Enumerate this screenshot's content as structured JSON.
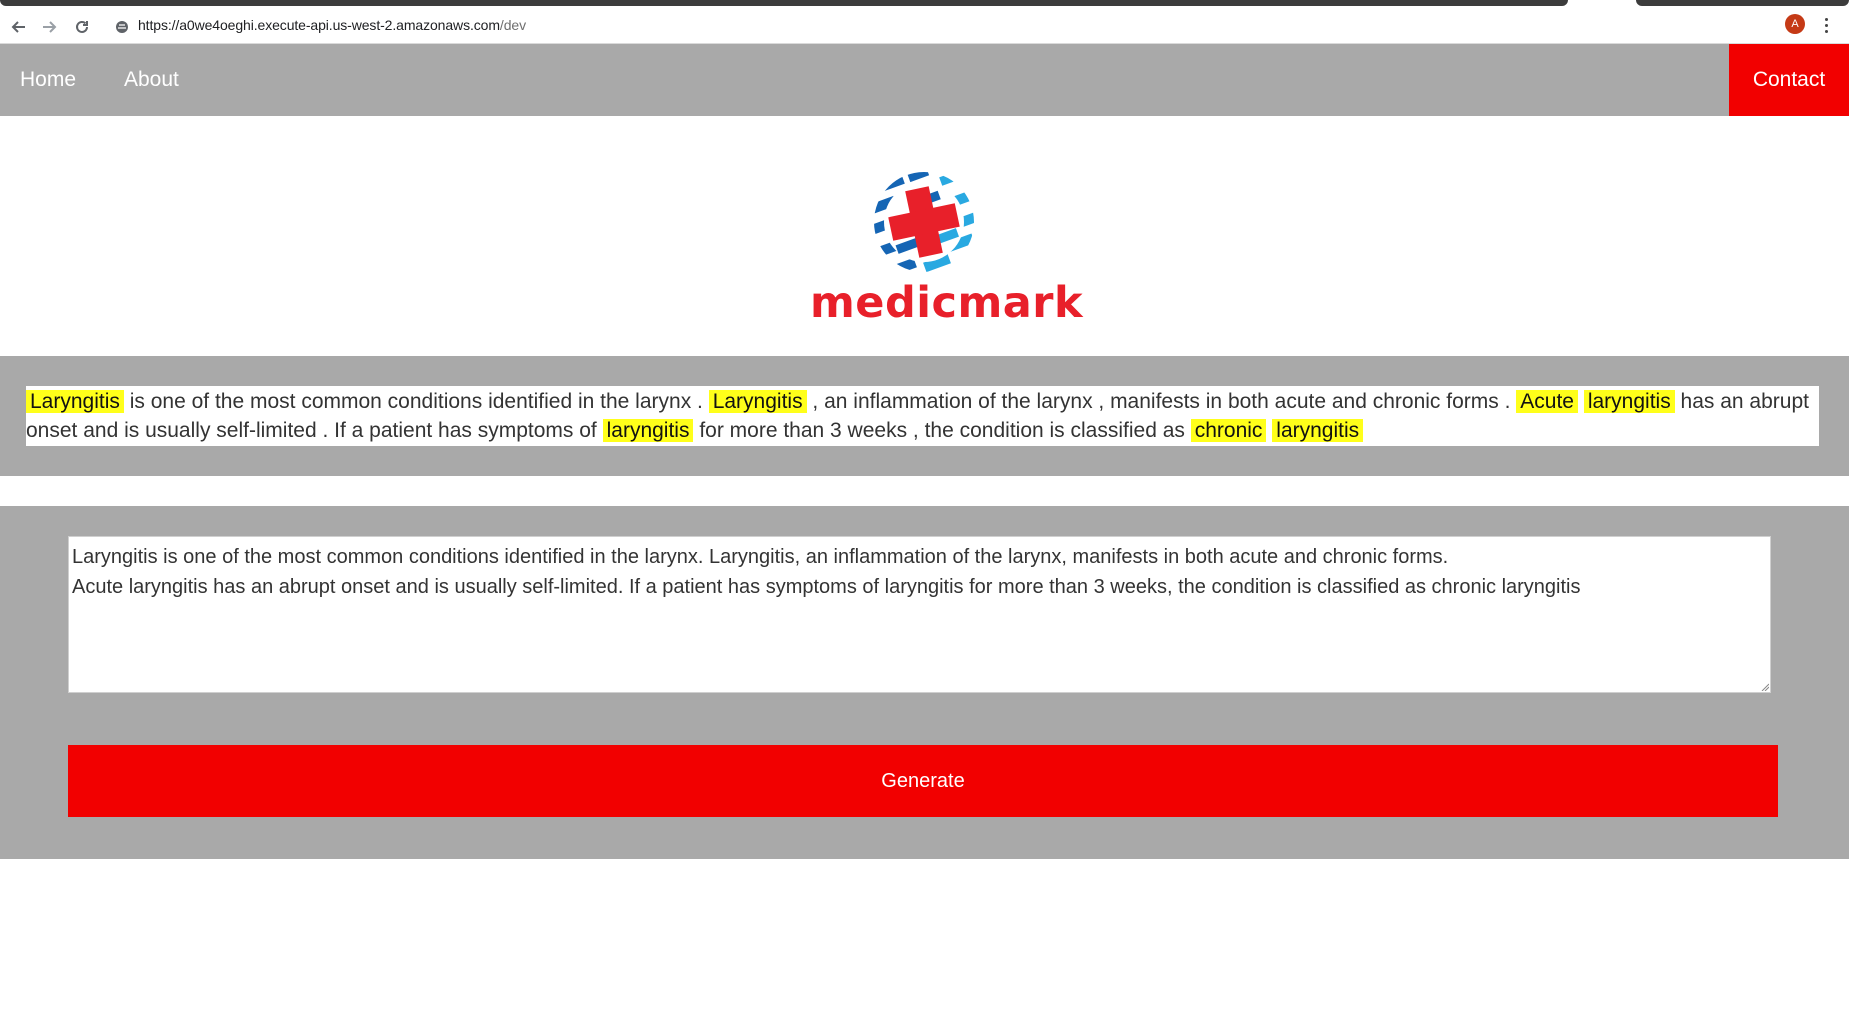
{
  "browser": {
    "url_main": "https://a0we4oeghi.execute-api.us-west-2.amazonaws.com",
    "url_path": "/dev",
    "avatar_initial": "A"
  },
  "nav": {
    "home": "Home",
    "about": "About",
    "contact": "Contact"
  },
  "logo": {
    "text": "medicmark"
  },
  "highlight": {
    "segments": [
      {
        "text": "Laryngitis",
        "hl": true
      },
      {
        "text": " is one of the most common conditions identified in the larynx . ",
        "hl": false
      },
      {
        "text": "Laryngitis",
        "hl": true
      },
      {
        "text": " , an inflammation of the larynx , manifests in both acute and chronic forms . ",
        "hl": false
      },
      {
        "text": "Acute",
        "hl": true
      },
      {
        "text": " ",
        "hl": false
      },
      {
        "text": "laryngitis",
        "hl": true
      },
      {
        "text": " has an abrupt onset and is usually self-limited . If a patient has symptoms of ",
        "hl": false
      },
      {
        "text": "laryngitis",
        "hl": true
      },
      {
        "text": " for more than 3 weeks , the condition is classified as ",
        "hl": false
      },
      {
        "text": "chronic",
        "hl": true
      },
      {
        "text": " ",
        "hl": false
      },
      {
        "text": "laryngitis",
        "hl": true
      }
    ]
  },
  "form": {
    "textarea_value": "Laryngitis is one of the most common conditions identified in the larynx. Laryngitis, an inflammation of the larynx, manifests in both acute and chronic forms.\nAcute laryngitis has an abrupt onset and is usually self-limited. If a patient has symptoms of laryngitis for more than 3 weeks, the condition is classified as chronic laryngitis",
    "generate_label": "Generate"
  },
  "colors": {
    "nav_bg": "#a9a9a9",
    "accent_red": "#f20000",
    "highlight": "#ffff1a",
    "logo_red": "#e8202a",
    "logo_blue": "#1565b4",
    "logo_cyan": "#29a9e1"
  }
}
